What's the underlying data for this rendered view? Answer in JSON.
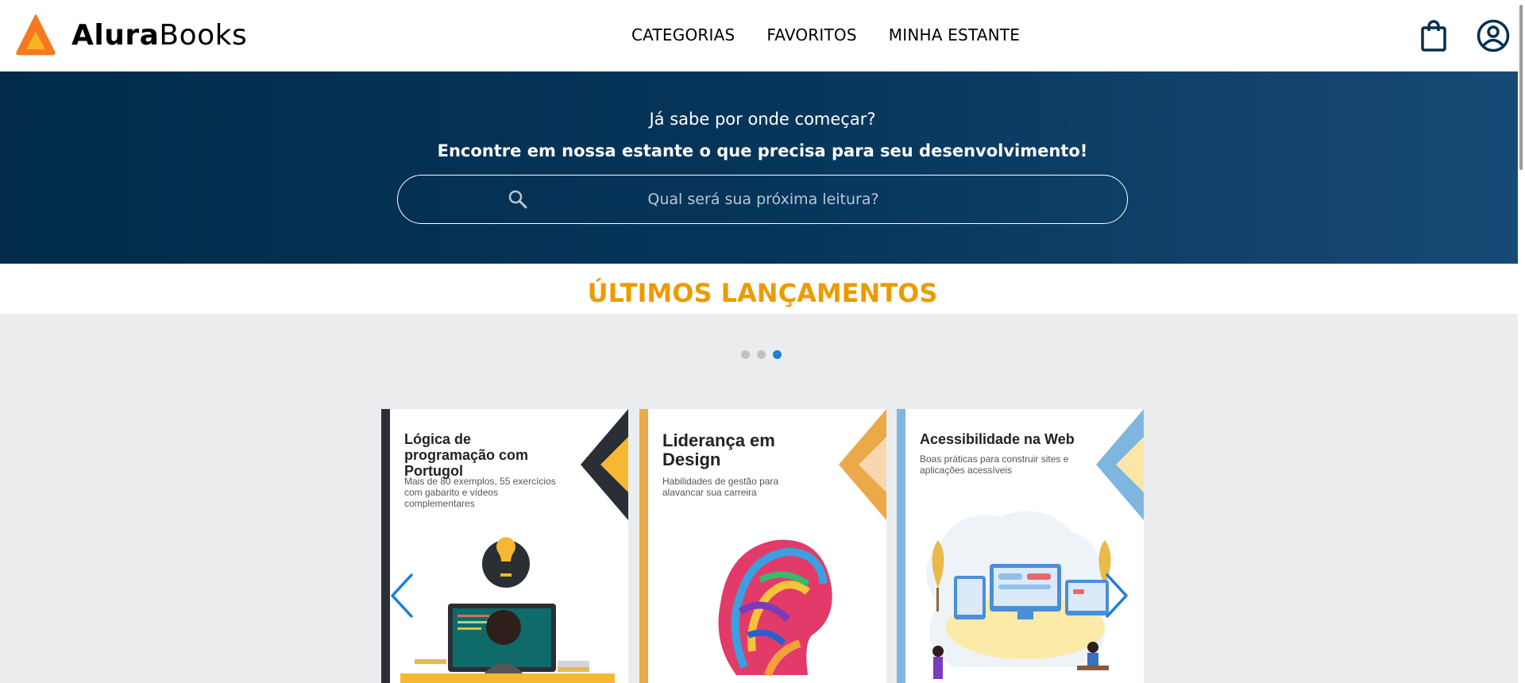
{
  "header": {
    "logo_bold": "Alura",
    "logo_light": "Books",
    "nav": [
      "CATEGORIAS",
      "FAVORITOS",
      "MINHA ESTANTE"
    ],
    "icons": [
      "bag-icon",
      "user-icon"
    ]
  },
  "hero": {
    "question": "Já sabe por onde começar?",
    "subtitle": "Encontre em nossa estante o que precisa para seu desenvolvimento!",
    "search_placeholder": "Qual será sua próxima leitura?"
  },
  "section": {
    "title": "ÚLTIMOS LANÇAMENTOS"
  },
  "carousel": {
    "dots": 3,
    "active_dot": 3,
    "books": [
      {
        "title": "Lógica de programação com Portugol",
        "description": "Mais de 80 exemplos, 55 exercícios com gabarito e vídeos complementares",
        "accent": "#f6b733",
        "strip": "#2a2f35"
      },
      {
        "title": "Liderança em Design",
        "description": "Habilidades de gestão para alavancar sua carreira",
        "accent": "#eba94a",
        "strip": "#eba94a"
      },
      {
        "title": "Acessibilidade na Web",
        "description": "Boas práticas para construir sites e aplicações acessíveis",
        "accent": "#7fb6e0",
        "strip": "#7fb6e0"
      }
    ]
  },
  "colors": {
    "brand_orange": "#eb9b00",
    "hero_bg": "#022b4a",
    "active_dot": "#1f7ed5"
  }
}
